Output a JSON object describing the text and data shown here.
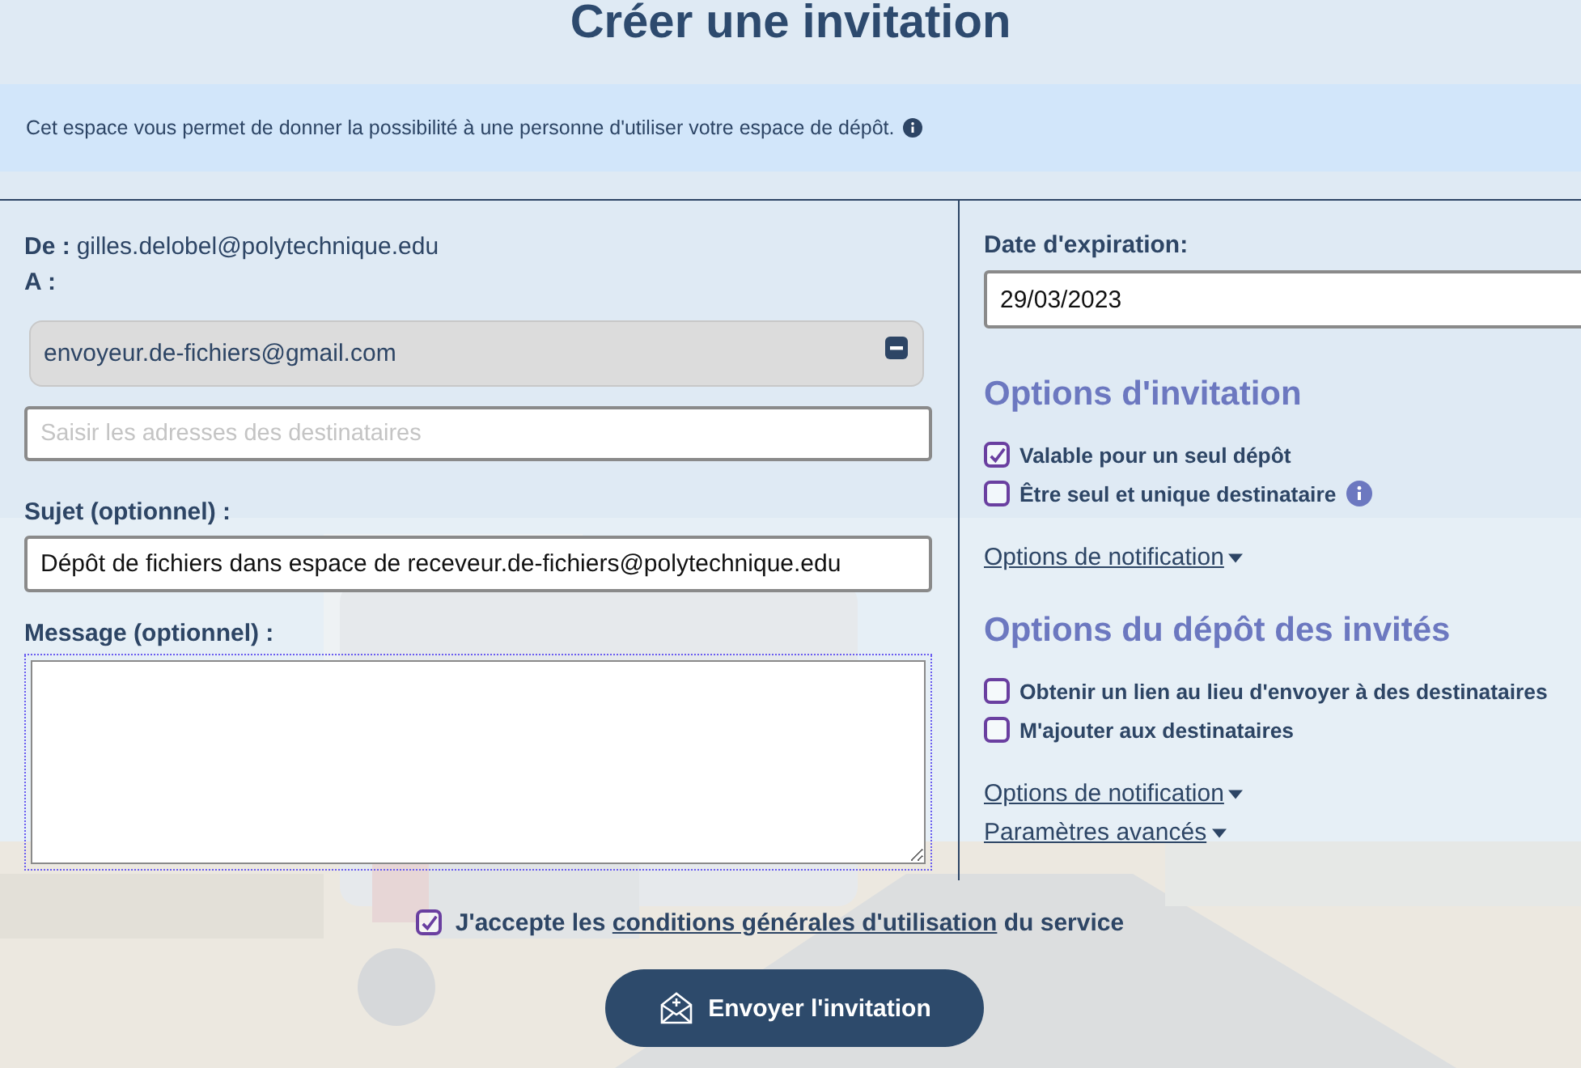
{
  "title": "Créer une invitation",
  "info": {
    "text": "Cet espace vous permet de donner la possibilité à une personne d'utiliser votre espace de dépôt."
  },
  "from": {
    "label": "De :",
    "value": "gilles.delobel@polytechnique.edu"
  },
  "to": {
    "label": "A :",
    "recipients": [
      {
        "email": "envoyeur.de-fichiers@gmail.com"
      }
    ],
    "placeholder": "Saisir les adresses des destinataires"
  },
  "subject": {
    "label": "Sujet (optionnel) :",
    "value": "Dépôt de fichiers dans espace de receveur.de-fichiers@polytechnique.edu"
  },
  "message": {
    "label": "Message (optionnel) :",
    "focused": true
  },
  "expiration": {
    "label": "Date d'expiration:",
    "value": "29/03/2023"
  },
  "sections": [
    {
      "title": "Options d'invitation",
      "options": [
        {
          "label": "Valable pour un seul dépôt",
          "checked": true,
          "info": false
        },
        {
          "label": "Être seul et unique destinataire",
          "checked": false,
          "info": true
        }
      ],
      "links": [
        "Options de notification"
      ]
    },
    {
      "title": "Options du dépôt des invités",
      "options": [
        {
          "label": "Obtenir un lien au lieu d'envoyer à des destinataires",
          "checked": false,
          "info": false
        },
        {
          "label": "M'ajouter aux destinataires",
          "checked": false,
          "info": false
        }
      ],
      "links": [
        "Options de notification",
        "Paramètres avancés"
      ]
    }
  ],
  "terms": {
    "checked": true,
    "before": "J'accepte les",
    "link": "conditions générales d'utilisation",
    "after": "du service"
  },
  "submit": "Envoyer l'invitation"
}
